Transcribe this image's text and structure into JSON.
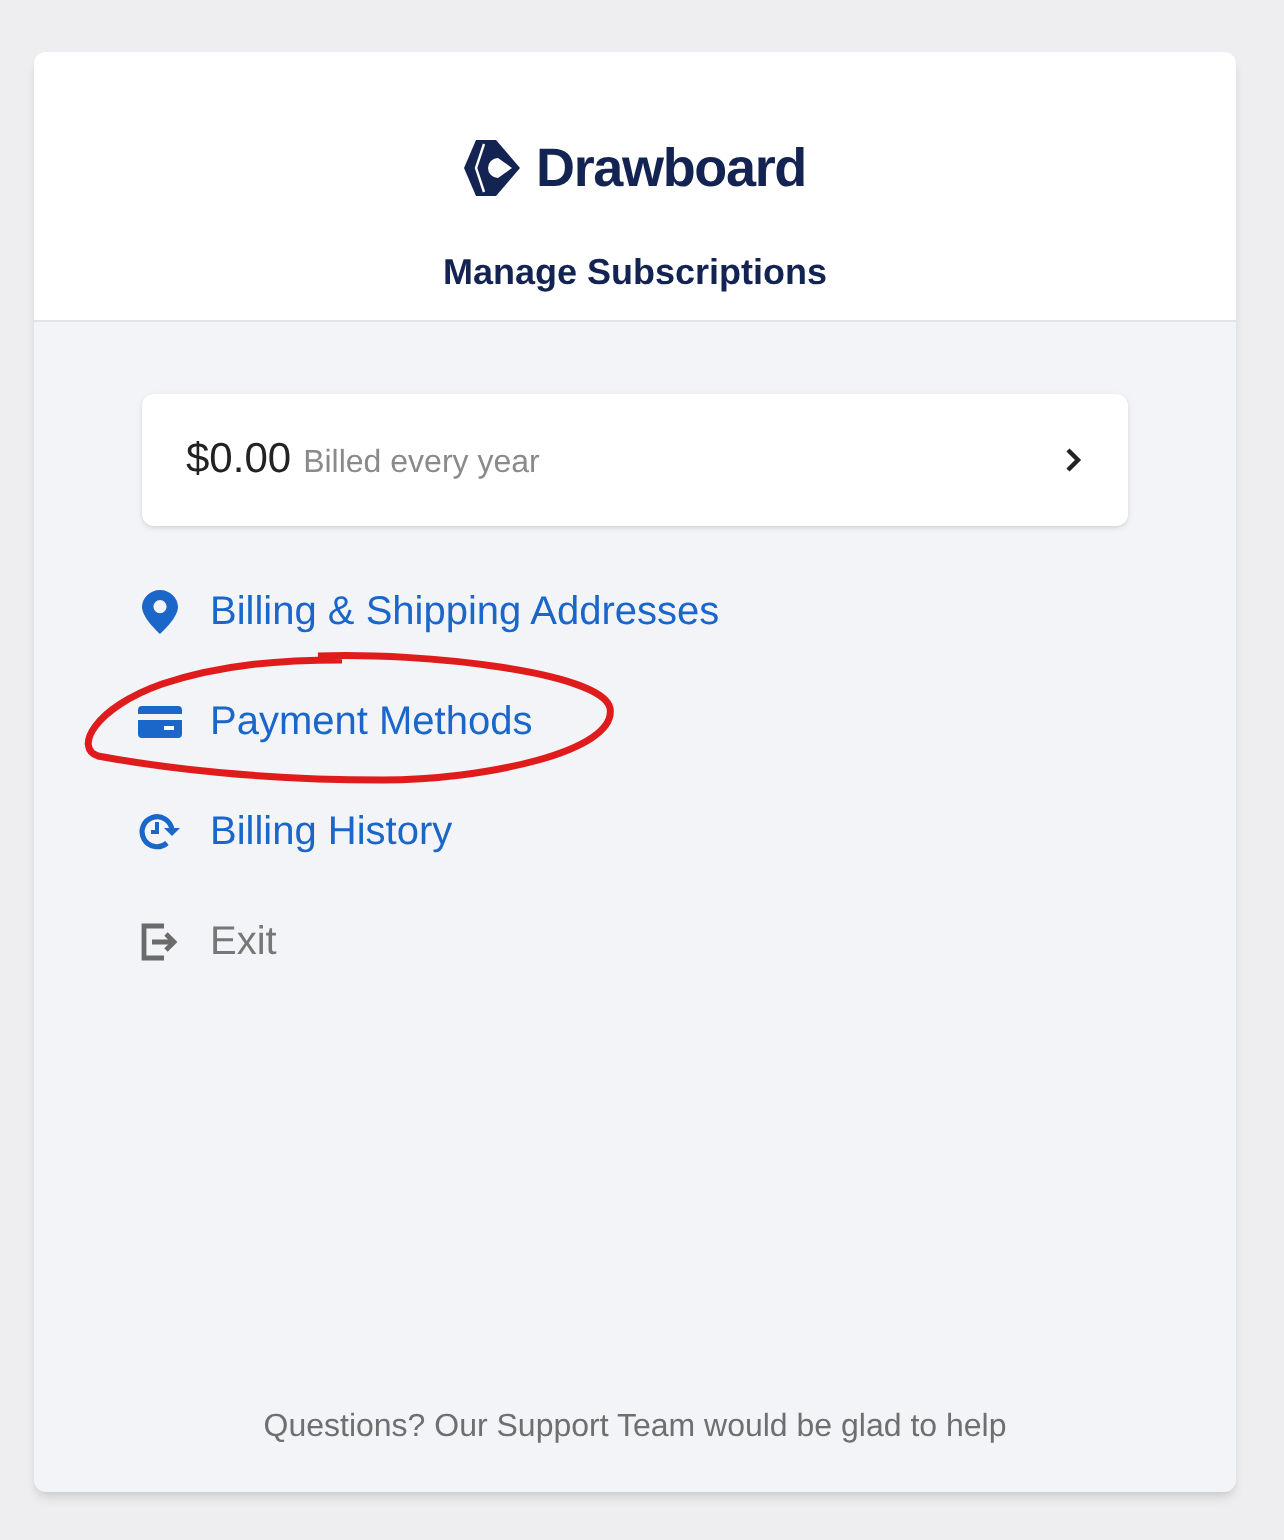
{
  "brand": {
    "name": "Drawboard"
  },
  "title": "Manage Subscriptions",
  "plan": {
    "price": "$0.00",
    "period": "Billed every year"
  },
  "menu": [
    {
      "kind": "address",
      "label": "Billing & Shipping Addresses",
      "circled": false
    },
    {
      "kind": "card",
      "label": "Payment Methods",
      "circled": true
    },
    {
      "kind": "history",
      "label": "Billing History",
      "circled": false
    },
    {
      "kind": "exit",
      "label": "Exit",
      "circled": false
    }
  ],
  "footer": "Questions? Our Support Team would be glad to help"
}
